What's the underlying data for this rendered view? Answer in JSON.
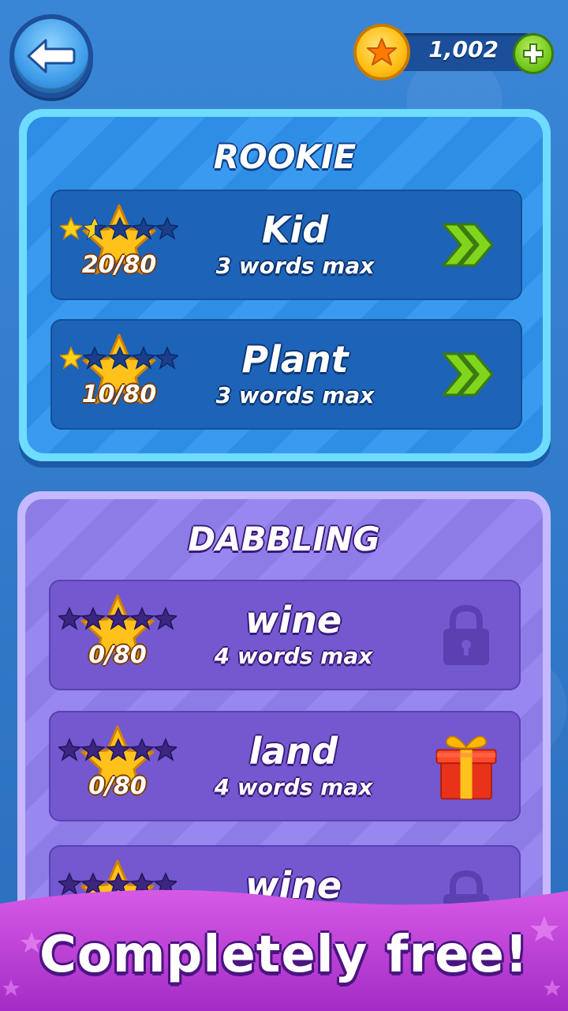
{
  "header": {
    "back_icon": "back-arrow-icon",
    "coins": "1,002",
    "coin_icon": "star-coin-icon",
    "add_icon": "plus-icon"
  },
  "sections": [
    {
      "title": "ROOKIE",
      "levels": [
        {
          "name": "Kid",
          "subtitle": "3 words max",
          "score": "20/80",
          "stars_earned": 1.5,
          "stars_total": 5,
          "action_icon": "double-chevron-right-icon"
        },
        {
          "name": "Plant",
          "subtitle": "3 words max",
          "score": "10/80",
          "stars_earned": 1,
          "stars_total": 5,
          "action_icon": "double-chevron-right-icon"
        }
      ]
    },
    {
      "title": "DABBLING",
      "levels": [
        {
          "name": "wine",
          "subtitle": "4 words max",
          "score": "0/80",
          "stars_earned": 0,
          "stars_total": 5,
          "action_icon": "lock-icon"
        },
        {
          "name": "land",
          "subtitle": "4 words max",
          "score": "0/80",
          "stars_earned": 0,
          "stars_total": 5,
          "action_icon": "gift-icon"
        },
        {
          "name": "wine",
          "subtitle": "",
          "score": "",
          "stars_earned": 0,
          "stars_total": 5,
          "action_icon": "lock-icon"
        }
      ]
    }
  ],
  "banner": {
    "text": "Completely free!"
  },
  "colors": {
    "rookie_accent": "#2e8ee6",
    "dabbling_accent": "#8d7ce6",
    "banner": "#c23fd8",
    "chevron": "#7fd61c",
    "star_gold": "#ffc21a"
  }
}
